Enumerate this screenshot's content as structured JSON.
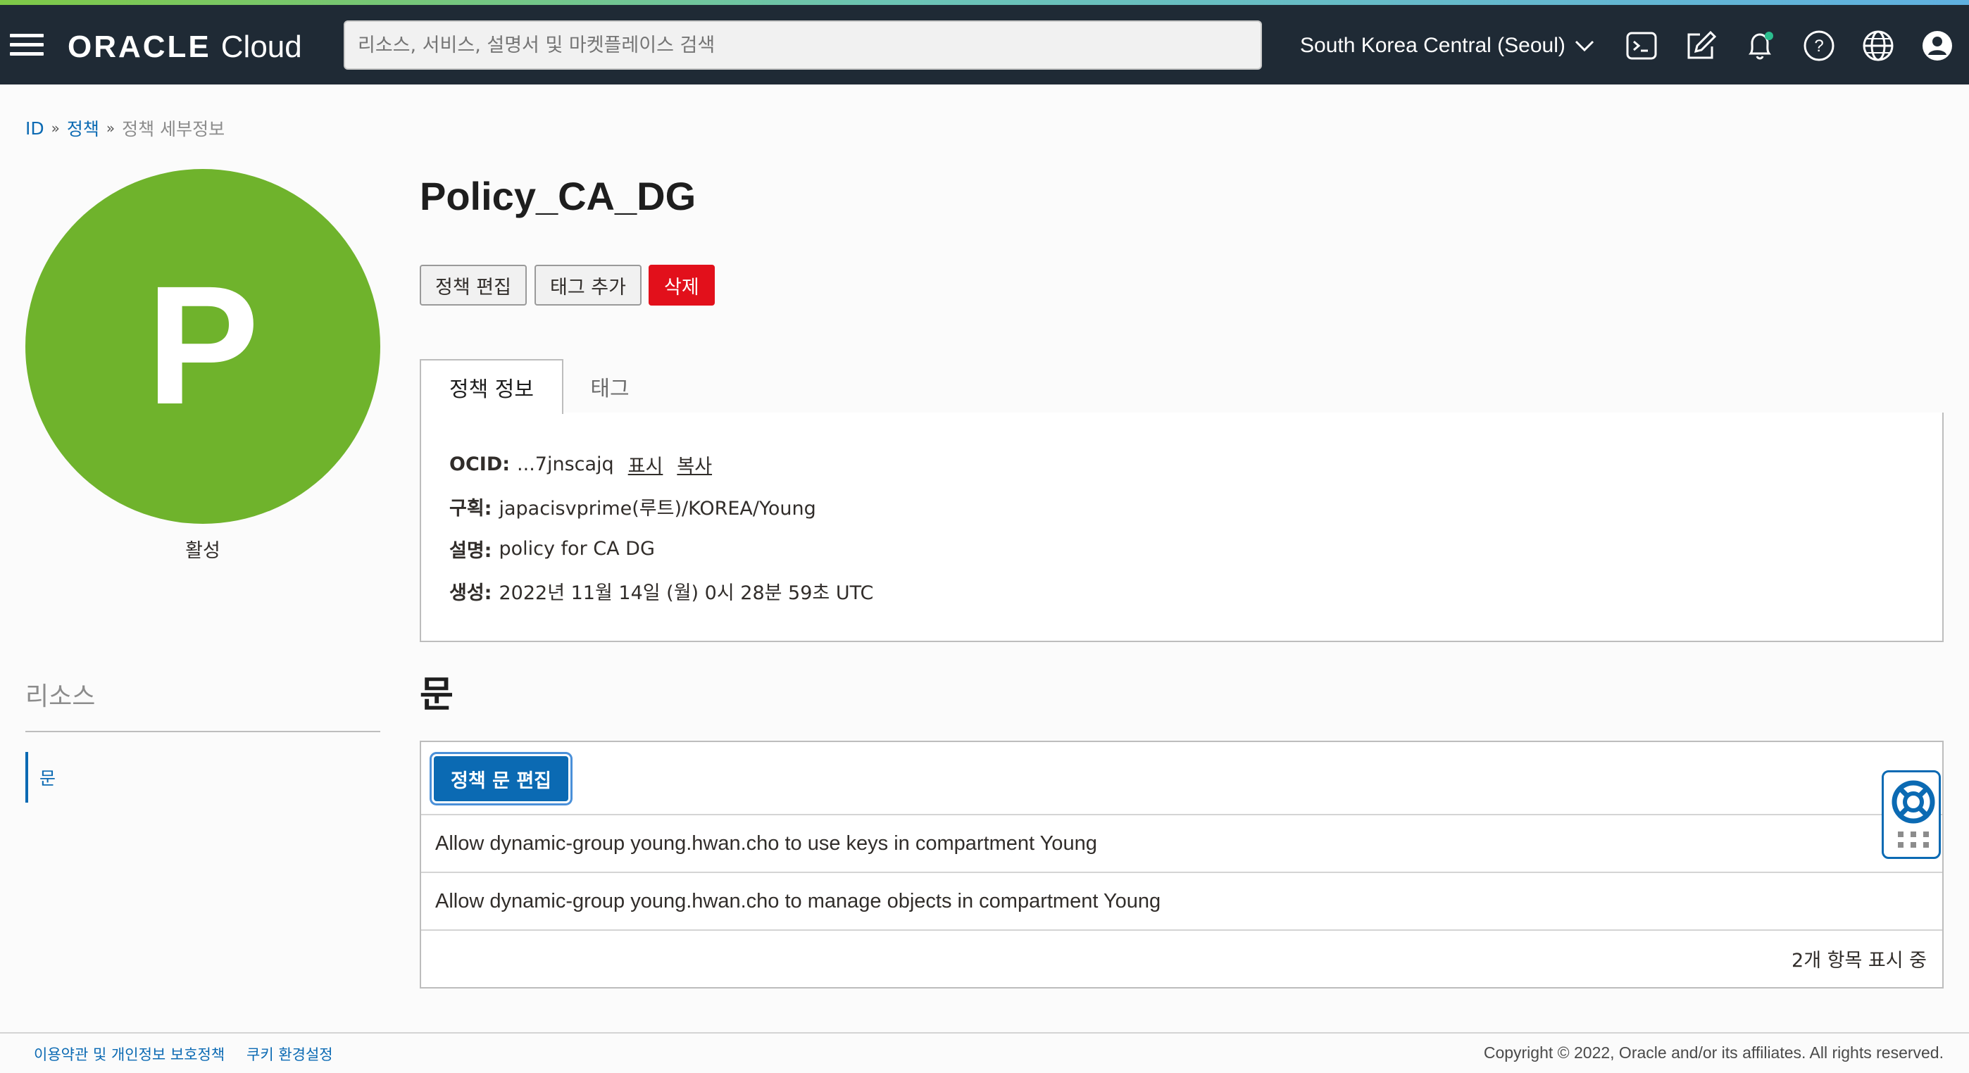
{
  "header": {
    "brand": "ORACLE",
    "product": "Cloud",
    "search_placeholder": "리소스, 서비스, 설명서 및 마켓플레이스 검색",
    "region": "South Korea Central (Seoul)",
    "icons": [
      "cloud-shell-icon",
      "edit-icon",
      "bell-icon",
      "help-icon",
      "globe-icon",
      "user-icon"
    ]
  },
  "breadcrumb": {
    "items": [
      "ID",
      "정책"
    ],
    "current": "정책 세부정보"
  },
  "avatar": {
    "letter": "P",
    "status": "활성",
    "color": "#6fb32c"
  },
  "resources": {
    "title": "리소스",
    "items": [
      "문"
    ]
  },
  "policy": {
    "name": "Policy_CA_DG",
    "actions": {
      "edit": "정책 편집",
      "add_tags": "태그 추가",
      "delete": "삭제"
    }
  },
  "tabs": [
    "정책 정보",
    "태그"
  ],
  "info": {
    "ocid_label": "OCID:",
    "ocid_value": "...7jnscajq",
    "show_link": "표시",
    "copy_link": "복사",
    "compartment_label": "구획:",
    "compartment_value": "japacisvprime(루트)/KOREA/Young",
    "description_label": "설명:",
    "description_value": "policy for CA DG",
    "created_label": "생성:",
    "created_value": "2022년 11월 14일 (월) 0시 28분 59초 UTC"
  },
  "statements": {
    "title": "문",
    "edit_button": "정책 문 편집",
    "rows": [
      "Allow dynamic-group young.hwan.cho to use keys in compartment Young",
      "Allow dynamic-group young.hwan.cho to manage objects in compartment Young"
    ],
    "count_text": "2개 항목 표시 중"
  },
  "footer": {
    "terms": "이용약관 및 개인정보 보호정책",
    "cookies": "쿠키 환경설정",
    "copyright": "Copyright © 2022, Oracle and/or its affiliates. All rights reserved."
  },
  "colors": {
    "header_bg": "#1f2a35",
    "accent": "#0b6ab3",
    "danger": "#e2101b",
    "avatar": "#6fb32c"
  }
}
